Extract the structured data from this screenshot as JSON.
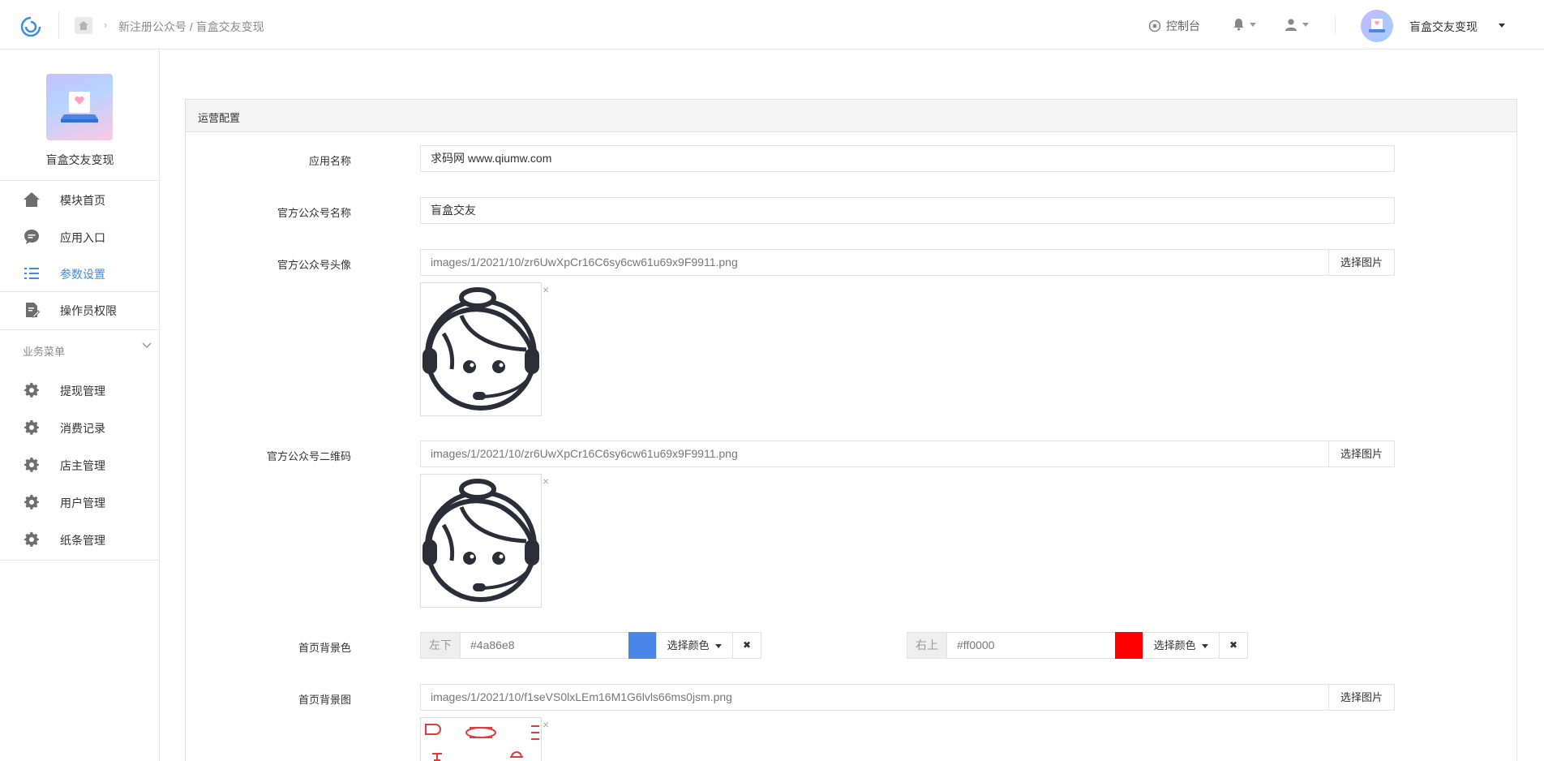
{
  "topbar": {
    "breadcrumb_text": "新注册公众号 / 盲盒交友变现",
    "console_label": "控制台",
    "account_name": "盲盒交友变现"
  },
  "sidebar": {
    "app_title": "盲盒交友变现",
    "items": [
      {
        "label": "模块首页",
        "icon": "home-icon"
      },
      {
        "label": "应用入口",
        "icon": "chat-icon"
      },
      {
        "label": "参数设置",
        "icon": "list-icon",
        "active": true
      },
      {
        "label": "操作员权限",
        "icon": "edit-doc-icon"
      }
    ],
    "group_title": "业务菜单",
    "group_items": [
      {
        "label": "提现管理",
        "icon": "gear-icon"
      },
      {
        "label": "消费记录",
        "icon": "gear-icon"
      },
      {
        "label": "店主管理",
        "icon": "gear-icon"
      },
      {
        "label": "用户管理",
        "icon": "gear-icon"
      },
      {
        "label": "纸条管理",
        "icon": "gear-icon"
      }
    ]
  },
  "panel": {
    "title": "运营配置",
    "fields": {
      "app_name": {
        "label": "应用名称",
        "value": "求码网 www.qiumw.com"
      },
      "official_name": {
        "label": "官方公众号名称",
        "value": "盲盒交友"
      },
      "official_avatar": {
        "label": "官方公众号头像",
        "value": "images/1/2021/10/zr6UwXpCr16C6sy6cw61u69x9F9911.png",
        "button": "选择图片"
      },
      "official_qrcode": {
        "label": "官方公众号二维码",
        "value": "images/1/2021/10/zr6UwXpCr16C6sy6cw61u69x9F9911.png",
        "button": "选择图片"
      },
      "home_bg_color": {
        "label": "首页背景色",
        "left": {
          "addon": "左下",
          "value": "#4a86e8",
          "color": "#4a86e8",
          "button": "选择颜色"
        },
        "right": {
          "addon": "右上",
          "value": "#ff0000",
          "color": "#ff0000",
          "button": "选择颜色"
        }
      },
      "home_bg_image": {
        "label": "首页背景图",
        "value": "images/1/2021/10/f1seVS0lxLEm16M1G6lvls66ms0jsm.png",
        "button": "选择图片"
      }
    },
    "remove_symbol": "×",
    "clear_symbol": "✖"
  }
}
